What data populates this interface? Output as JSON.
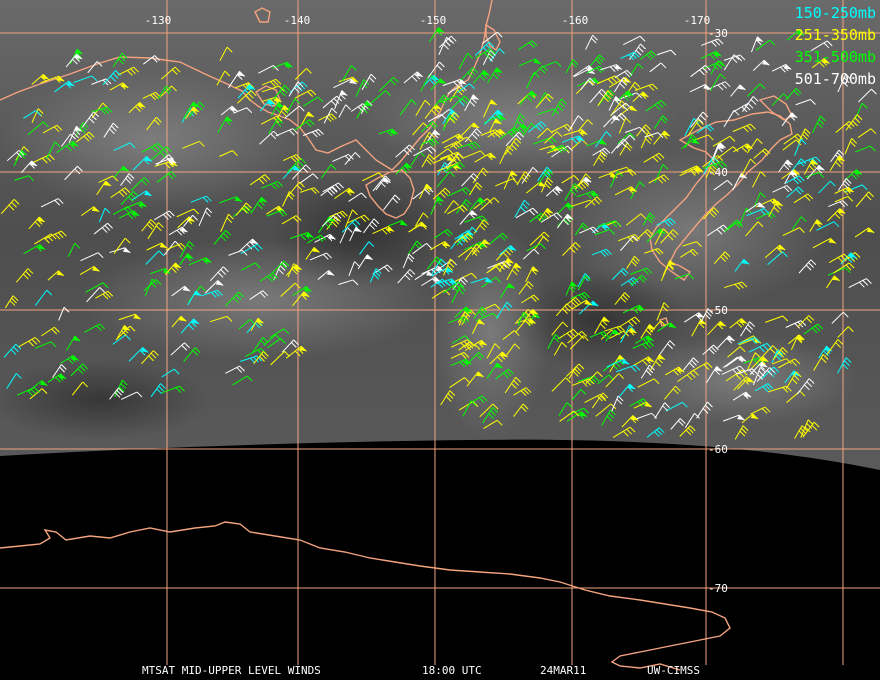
{
  "legend": [
    {
      "label": "150-250mb",
      "color": "#00ffff"
    },
    {
      "label": "251-350mb",
      "color": "#ffff00"
    },
    {
      "label": "351-500mb",
      "color": "#00ff00"
    },
    {
      "label": "501-700mb",
      "color": "#ffffff"
    }
  ],
  "longitude_labels": [
    "-130",
    "-140",
    "-150",
    "-160",
    "-170"
  ],
  "latitude_labels": [
    "-30",
    "-40",
    "-50",
    "-60",
    "-70"
  ],
  "caption": {
    "product": "MTSAT MID-UPPER LEVEL WINDS",
    "time": "18:00 UTC",
    "date": "24MAR11",
    "source": "UW-CIMSS"
  },
  "colors": {
    "grid": "#f4a37f",
    "coastline": "#f4a37f",
    "background_space": "#000000",
    "imagery_gray": "#555555"
  }
}
